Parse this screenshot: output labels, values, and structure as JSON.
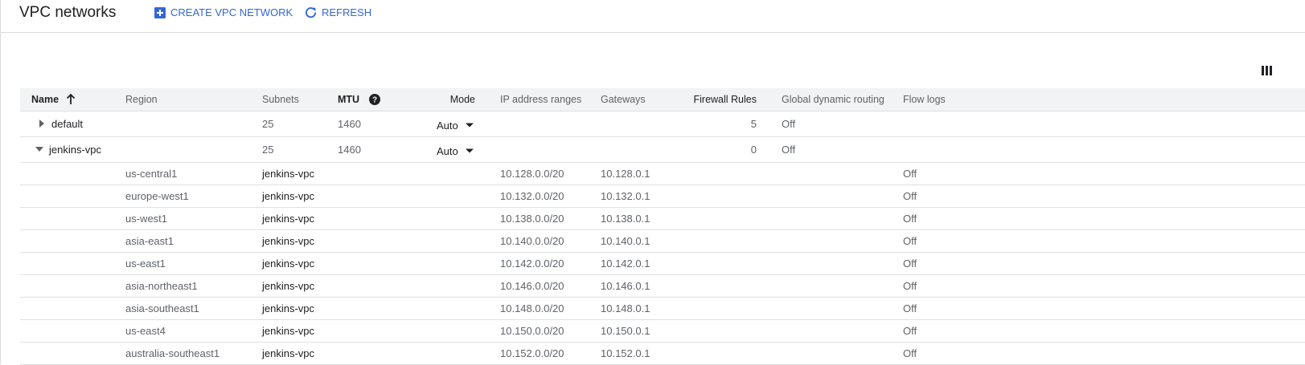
{
  "header": {
    "title": "VPC networks",
    "create_label": "CREATE VPC NETWORK",
    "refresh_label": "REFRESH"
  },
  "columns": {
    "name": "Name",
    "region": "Region",
    "subnets": "Subnets",
    "mtu": "MTU",
    "mode": "Mode",
    "ip_ranges": "IP address ranges",
    "gateways": "Gateways",
    "firewall_rules": "Firewall Rules",
    "global_routing": "Global dynamic routing",
    "flow_logs": "Flow logs"
  },
  "networks": [
    {
      "name": "default",
      "expanded": false,
      "subnets": "25",
      "mtu": "1460",
      "mode": "Auto",
      "firewall_rules": "5",
      "global_routing": "Off"
    },
    {
      "name": "jenkins-vpc",
      "expanded": true,
      "subnets": "25",
      "mtu": "1460",
      "mode": "Auto",
      "firewall_rules": "0",
      "global_routing": "Off"
    }
  ],
  "subnets": [
    {
      "region": "us-central1",
      "network": "jenkins-vpc",
      "ip_range": "10.128.0.0/20",
      "gateway": "10.128.0.1",
      "flow_logs": "Off"
    },
    {
      "region": "europe-west1",
      "network": "jenkins-vpc",
      "ip_range": "10.132.0.0/20",
      "gateway": "10.132.0.1",
      "flow_logs": "Off"
    },
    {
      "region": "us-west1",
      "network": "jenkins-vpc",
      "ip_range": "10.138.0.0/20",
      "gateway": "10.138.0.1",
      "flow_logs": "Off"
    },
    {
      "region": "asia-east1",
      "network": "jenkins-vpc",
      "ip_range": "10.140.0.0/20",
      "gateway": "10.140.0.1",
      "flow_logs": "Off"
    },
    {
      "region": "us-east1",
      "network": "jenkins-vpc",
      "ip_range": "10.142.0.0/20",
      "gateway": "10.142.0.1",
      "flow_logs": "Off"
    },
    {
      "region": "asia-northeast1",
      "network": "jenkins-vpc",
      "ip_range": "10.146.0.0/20",
      "gateway": "10.146.0.1",
      "flow_logs": "Off"
    },
    {
      "region": "asia-southeast1",
      "network": "jenkins-vpc",
      "ip_range": "10.148.0.0/20",
      "gateway": "10.148.0.1",
      "flow_logs": "Off"
    },
    {
      "region": "us-east4",
      "network": "jenkins-vpc",
      "ip_range": "10.150.0.0/20",
      "gateway": "10.150.0.1",
      "flow_logs": "Off"
    },
    {
      "region": "australia-southeast1",
      "network": "jenkins-vpc",
      "ip_range": "10.152.0.0/20",
      "gateway": "10.152.0.1",
      "flow_logs": "Off"
    }
  ],
  "icons": {
    "create": "add-box-icon",
    "refresh": "refresh-icon",
    "columns": "column-display-icon",
    "sort": "arrow-up-icon",
    "help": "help-icon",
    "expand": "triangle-right-icon",
    "collapse": "triangle-down-icon",
    "dropdown": "dropdown-icon"
  },
  "colors": {
    "accent": "#3367d6",
    "header_bg": "#f1f3f4",
    "text": "#202124",
    "muted": "#5f6368"
  }
}
